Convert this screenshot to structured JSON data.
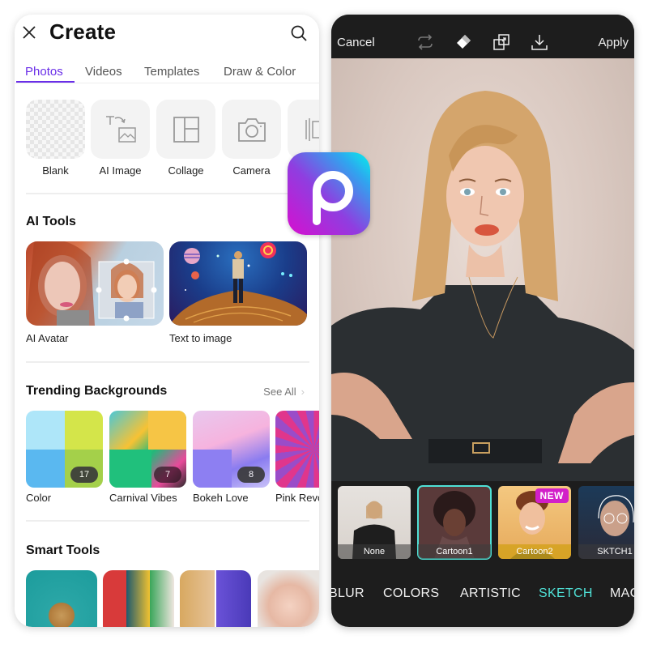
{
  "left_panel": {
    "title": "Create",
    "tabs": [
      {
        "label": "Photos",
        "active": true
      },
      {
        "label": "Videos",
        "active": false
      },
      {
        "label": "Templates",
        "active": false
      },
      {
        "label": "Draw & Color",
        "active": false
      }
    ],
    "quick_actions": [
      {
        "label": "Blank",
        "icon": "transparent-checker-icon"
      },
      {
        "label": "AI Image",
        "icon": "text-to-image-icon"
      },
      {
        "label": "Collage",
        "icon": "collage-grid-icon"
      },
      {
        "label": "Camera",
        "icon": "camera-icon"
      },
      {
        "label": "",
        "icon": "frames-icon"
      }
    ],
    "ai_tools": {
      "title": "AI Tools",
      "items": [
        {
          "label": "AI Avatar"
        },
        {
          "label": "Text to image"
        }
      ]
    },
    "trending_backgrounds": {
      "title": "Trending Backgrounds",
      "see_all": "See All",
      "items": [
        {
          "label": "Color",
          "count": "17"
        },
        {
          "label": "Carnival Vibes",
          "count": "7"
        },
        {
          "label": "Bokeh Love",
          "count": "8"
        },
        {
          "label": "Pink Revo",
          "count": ""
        }
      ]
    },
    "smart_tools": {
      "title": "Smart Tools",
      "items": [
        {
          "name": "curly-hair-portrait"
        },
        {
          "name": "outfit-variations"
        },
        {
          "name": "hair-color-split"
        },
        {
          "name": "makeup-portrait"
        }
      ]
    }
  },
  "right_panel": {
    "cancel": "Cancel",
    "apply": "Apply",
    "toolbar_icons": [
      "swap-icon",
      "eraser-icon",
      "compare-icon",
      "download-icon"
    ],
    "effects": [
      {
        "label": "None",
        "selected": false,
        "badge": ""
      },
      {
        "label": "Cartoon1",
        "selected": true,
        "badge": ""
      },
      {
        "label": "Cartoon2",
        "selected": false,
        "badge": "NEW"
      },
      {
        "label": "SKTCH1",
        "selected": false,
        "badge": ""
      }
    ],
    "categories": [
      {
        "label": "BLUR",
        "active": false
      },
      {
        "label": "COLORS",
        "active": false
      },
      {
        "label": "ARTISTIC",
        "active": false
      },
      {
        "label": "SKETCH",
        "active": true
      },
      {
        "label": "MAG",
        "active": false
      }
    ]
  },
  "colors": {
    "accent_purple": "#6a2ee8",
    "accent_teal": "#4fe0d6",
    "badge_magenta": "#d21fc9",
    "dark_bg": "#1d1d1d"
  }
}
